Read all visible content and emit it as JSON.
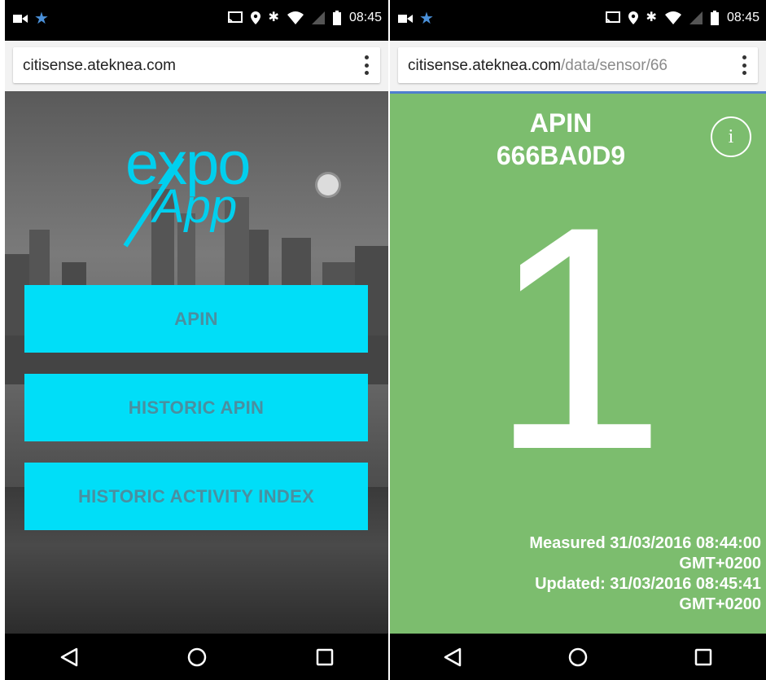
{
  "status_bar": {
    "time": "08:45",
    "left_icons": [
      "video-camera-icon",
      "star-icon"
    ],
    "right_icons": [
      "cast-icon",
      "location-icon",
      "bluetooth-icon",
      "wifi-icon",
      "no-signal-icon",
      "battery-icon"
    ]
  },
  "left_screen": {
    "url": "citisense.ateknea.com",
    "logo": {
      "line1": "expo",
      "line2": "App"
    },
    "buttons": [
      {
        "label": "APIN"
      },
      {
        "label": "HISTORIC APIN"
      },
      {
        "label": "HISTORIC ACTIVITY INDEX"
      }
    ],
    "colors": {
      "button_bg": "#00def8",
      "button_text": "#4a8fa0",
      "logo": "#00cfee"
    }
  },
  "right_screen": {
    "url_host": "citisense.ateknea.com",
    "url_path": "/data/sensor/66",
    "sensor": {
      "name": "APIN",
      "id": "666BA0D9"
    },
    "value": "1",
    "measured": "Measured 31/03/2016 08:44:00",
    "measured_tz": "GMT+0200",
    "updated": "Updated: 31/03/2016 08:45:41",
    "updated_tz": "GMT+0200",
    "colors": {
      "background": "#7cbd6e",
      "accent_line": "#4f7fcf"
    }
  },
  "nav_bar": {
    "icons": [
      "back-icon",
      "home-icon",
      "recents-icon"
    ]
  }
}
